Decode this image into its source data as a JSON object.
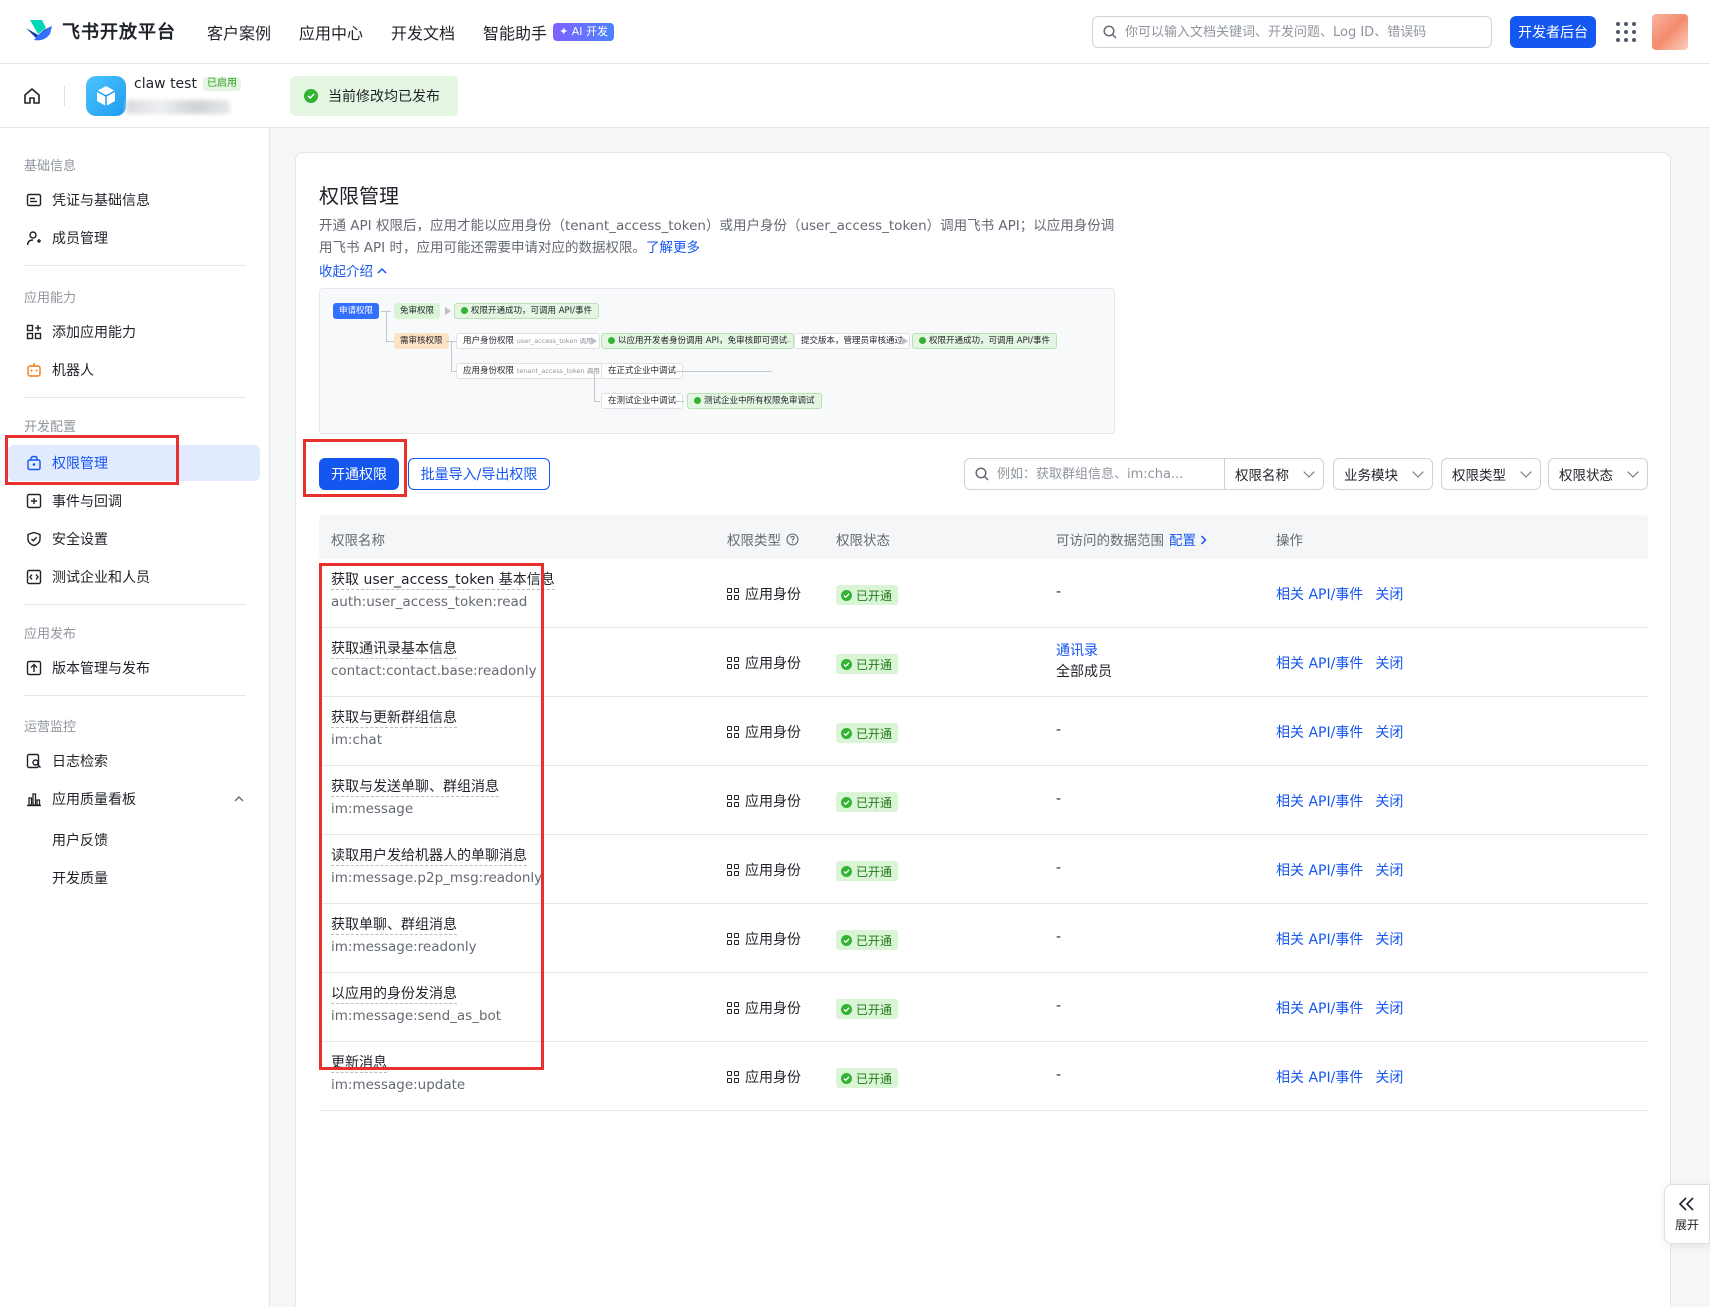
{
  "topnav": {
    "brand": "飞书开放平台",
    "links": [
      "客户案例",
      "应用中心",
      "开发文档",
      "智能助手"
    ],
    "ai_badge": "✦ AI 开发",
    "search_placeholder": "你可以输入文档关键词、开发问题、Log ID、错误码",
    "dev_button": "开发者后台"
  },
  "appbar": {
    "app_name": "claw test",
    "app_status": "已启用",
    "publish_status": "当前修改均已发布"
  },
  "sidebar": {
    "sections": [
      {
        "title": "基础信息",
        "items": [
          "凭证与基础信息",
          "成员管理"
        ]
      },
      {
        "title": "应用能力",
        "items": [
          "添加应用能力",
          "机器人"
        ]
      },
      {
        "title": "开发配置",
        "items": [
          "权限管理",
          "事件与回调",
          "安全设置",
          "测试企业和人员"
        ]
      },
      {
        "title": "应用发布",
        "items": [
          "版本管理与发布"
        ]
      },
      {
        "title": "运营监控",
        "items": [
          "日志检索",
          "应用质量看板"
        ]
      }
    ],
    "sub_items": [
      "用户反馈",
      "开发质量"
    ],
    "active_item": "权限管理"
  },
  "main": {
    "title": "权限管理",
    "intro": "开通 API 权限后，应用才能以应用身份（tenant_access_token）或用户身份（user_access_token）调用飞书 API；以应用身份调用飞书 API 时，应用可能还需要申请对应的数据权限。",
    "learn_more": "了解更多",
    "collapse": "收起介绍",
    "flow": {
      "apply": "申请权限",
      "no_review": "免审权限",
      "no_review_result": "权限开通成功，可调用 API/事件",
      "need_review": "需审核权限",
      "user_identity": "用户身份权限",
      "user_identity_sub": "user_access_token 调用",
      "app_identity": "应用身份权限",
      "app_identity_sub": "tenant_access_token 调用",
      "debug_dev": "以应用开发者身份调用 API，免审核即可调试",
      "submit": "提交版本，管理员审核通过",
      "final_result": "权限开通成功，可调用 API/事件",
      "prod_debug": "在正式企业中调试",
      "test_debug": "在测试企业中调试",
      "test_result": "测试企业中所有权限免审调试"
    },
    "open_button": "开通权限",
    "import_button": "批量导入/导出权限",
    "filter_placeholder": "例如：获取群组信息、im:cha...",
    "filters": [
      "权限名称",
      "业务模块",
      "权限类型",
      "权限状态"
    ]
  },
  "table": {
    "headers": {
      "name": "权限名称",
      "type": "权限类型",
      "status": "权限状态",
      "scope": "可访问的数据范围",
      "scope_config": "配置",
      "ops": "操作"
    },
    "rows": [
      {
        "name": "获取 user_access_token 基本信息",
        "key": "auth:user_access_token:read",
        "type": "应用身份",
        "status": "已开通",
        "scope": "-",
        "scope_link": "",
        "op1": "相关 API/事件",
        "op2": "关闭"
      },
      {
        "name": "获取通讯录基本信息",
        "key": "contact:contact.base:readonly",
        "type": "应用身份",
        "status": "已开通",
        "scope": "全部成员",
        "scope_link": "通讯录",
        "op1": "相关 API/事件",
        "op2": "关闭"
      },
      {
        "name": "获取与更新群组信息",
        "key": "im:chat",
        "type": "应用身份",
        "status": "已开通",
        "scope": "-",
        "scope_link": "",
        "op1": "相关 API/事件",
        "op2": "关闭"
      },
      {
        "name": "获取与发送单聊、群组消息",
        "key": "im:message",
        "type": "应用身份",
        "status": "已开通",
        "scope": "-",
        "scope_link": "",
        "op1": "相关 API/事件",
        "op2": "关闭"
      },
      {
        "name": "读取用户发给机器人的单聊消息",
        "key": "im:message.p2p_msg:readonly",
        "type": "应用身份",
        "status": "已开通",
        "scope": "-",
        "scope_link": "",
        "op1": "相关 API/事件",
        "op2": "关闭"
      },
      {
        "name": "获取单聊、群组消息",
        "key": "im:message:readonly",
        "type": "应用身份",
        "status": "已开通",
        "scope": "-",
        "scope_link": "",
        "op1": "相关 API/事件",
        "op2": "关闭"
      },
      {
        "name": "以应用的身份发消息",
        "key": "im:message:send_as_bot",
        "type": "应用身份",
        "status": "已开通",
        "scope": "-",
        "scope_link": "",
        "op1": "相关 API/事件",
        "op2": "关闭"
      },
      {
        "name": "更新消息",
        "key": "im:message:update",
        "type": "应用身份",
        "status": "已开通",
        "scope": "-",
        "scope_link": "",
        "op1": "相关 API/事件",
        "op2": "关闭"
      }
    ]
  },
  "expand_label": "展开",
  "colors": {
    "primary": "#1456f0",
    "success": "#34b233",
    "highlight_box": "#e8312f",
    "active_bg": "#e1eaff"
  }
}
